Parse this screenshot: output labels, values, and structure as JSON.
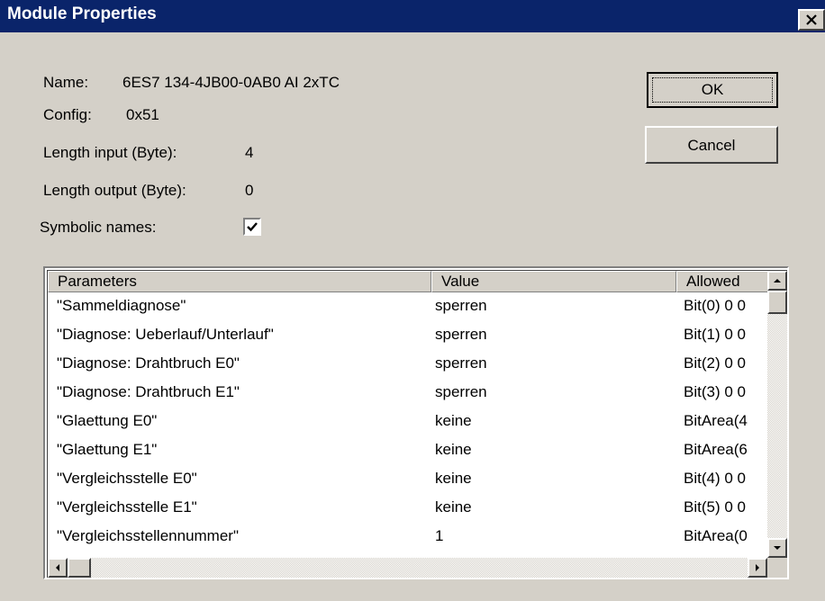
{
  "window": {
    "title": "Module Properties"
  },
  "info": {
    "name_label": "Name:",
    "name_value": "6ES7 134-4JB00-0AB0 AI 2xTC",
    "config_label": "Config:",
    "config_value": "0x51",
    "length_input_label": "Length input (Byte):",
    "length_input_value": "4",
    "length_output_label": "Length output (Byte):",
    "length_output_value": "0",
    "symbolic_names_label": "Symbolic names:",
    "symbolic_names_checked": true
  },
  "buttons": {
    "ok": "OK",
    "cancel": "Cancel"
  },
  "table": {
    "headers": [
      "Parameters",
      "Value",
      "Allowed"
    ],
    "rows": [
      {
        "parameter": "\"Sammeldiagnose\"",
        "value": "sperren",
        "allowed": "Bit(0) 0 0"
      },
      {
        "parameter": "\"Diagnose: Ueberlauf/Unterlauf\"",
        "value": "sperren",
        "allowed": "Bit(1) 0 0"
      },
      {
        "parameter": "\"Diagnose: Drahtbruch E0\"",
        "value": "sperren",
        "allowed": "Bit(2) 0 0"
      },
      {
        "parameter": "\"Diagnose: Drahtbruch E1\"",
        "value": "sperren",
        "allowed": "Bit(3) 0 0"
      },
      {
        "parameter": "\"Glaettung E0\"",
        "value": "keine",
        "allowed": "BitArea(4"
      },
      {
        "parameter": "\"Glaettung E1\"",
        "value": "keine",
        "allowed": "BitArea(6"
      },
      {
        "parameter": "\"Vergleichsstelle E0\"",
        "value": "keine",
        "allowed": "Bit(4) 0 0"
      },
      {
        "parameter": "\"Vergleichsstelle E1\"",
        "value": "keine",
        "allowed": "Bit(5) 0 0"
      },
      {
        "parameter": "\"Vergleichsstellennummer\"",
        "value": "1",
        "allowed": "BitArea(0"
      }
    ]
  }
}
